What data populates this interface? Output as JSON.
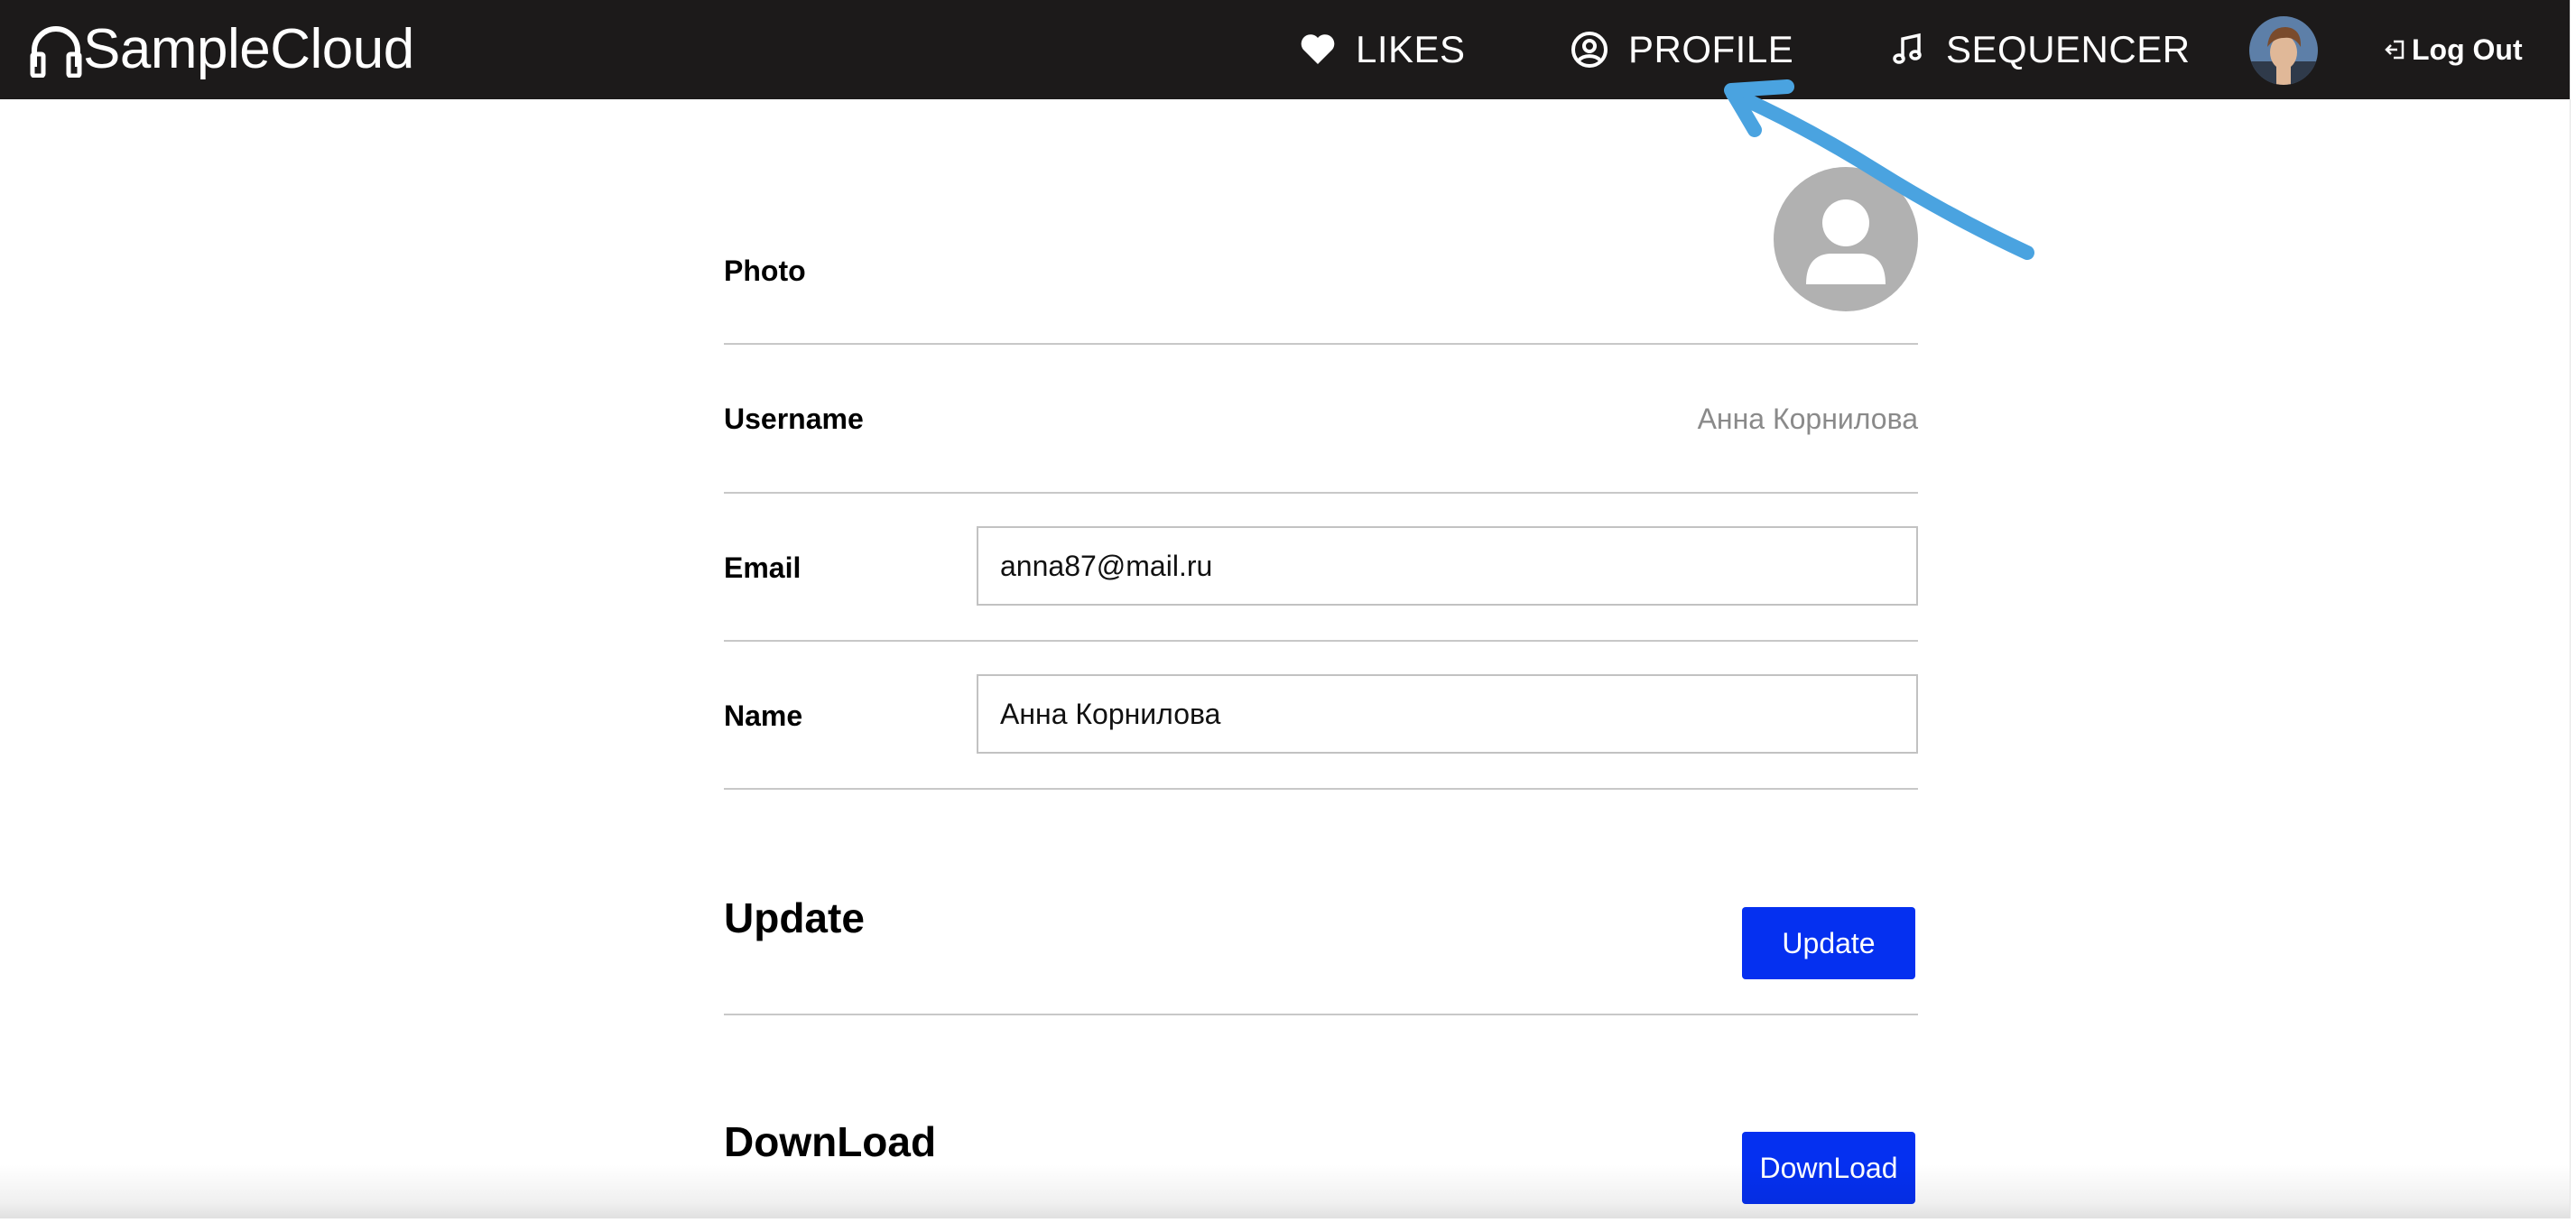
{
  "app": {
    "brand": "SampleCloud"
  },
  "nav": {
    "likes": "LIKES",
    "profile": "PROFILE",
    "sequencer": "SEQUENCER",
    "logout": "Log Out"
  },
  "profile": {
    "photo_label": "Photo",
    "username_label": "Username",
    "username_value": "Анна Корнилова",
    "email_label": "Email",
    "email_value": "anna87@mail.ru",
    "name_label": "Name",
    "name_value": "Анна Корнилова"
  },
  "update": {
    "title": "Update",
    "button": "Update"
  },
  "download": {
    "title": "DownLoad",
    "button": "DownLoad"
  },
  "colors": {
    "navbar": "#1c1a1a",
    "primary_button": "#0530f0",
    "annotation_arrow": "#4aa3e0",
    "placeholder_avatar": "#b1b1b1"
  },
  "icons": {
    "brand": "headphones-icon",
    "likes": "heart-icon",
    "profile": "user-circle-icon",
    "sequencer": "music-note-icon",
    "logout": "logout-icon"
  }
}
